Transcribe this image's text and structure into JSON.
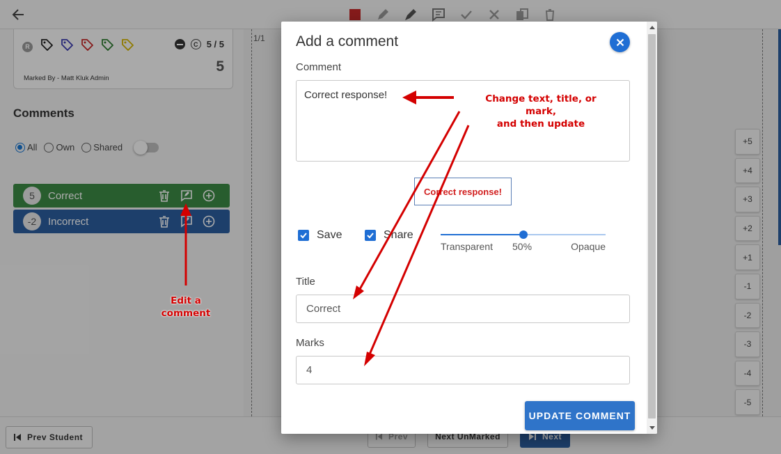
{
  "toolbar": {
    "icons": [
      "back-arrow-icon",
      "stop-icon",
      "pencil-icon",
      "marker-icon",
      "comment-icon",
      "check-icon",
      "cross-icon",
      "copy-icon",
      "trash-icon"
    ]
  },
  "mark_card": {
    "score_fraction": "5 / 5",
    "score_total": "5",
    "marked_by": "Marked By - Matt Kluk Admin",
    "tag_colors": [
      "#222222",
      "#3b3bb0",
      "#c62828",
      "#2e7d32",
      "#d4b400"
    ]
  },
  "comments_panel": {
    "heading": "Comments",
    "filters": [
      "All",
      "Own",
      "Shared"
    ],
    "selected_filter": "All",
    "items": [
      {
        "mark": "5",
        "title": "Correct",
        "color": "#3c8a45"
      },
      {
        "mark": "-2",
        "title": "Incorrect",
        "color": "#2c5e9e"
      }
    ]
  },
  "document": {
    "page_count": "1/1"
  },
  "quick_marks": [
    "+5",
    "+4",
    "+3",
    "+2",
    "+1",
    "-1",
    "-2",
    "-3",
    "-4",
    "-5"
  ],
  "bottom_bar": {
    "prev_student": "Prev Student",
    "prev": "Prev",
    "next_unmarked": "Next UnMarked",
    "next": "Next"
  },
  "modal": {
    "title": "Add a comment",
    "comment_label": "Comment",
    "comment_value": "Correct response!",
    "preview_text": "Correct response!",
    "save_label": "Save",
    "save_checked": true,
    "share_label": "Share",
    "share_checked": true,
    "opacity": {
      "left_label": "Transparent",
      "value_label": "50%",
      "right_label": "Opaque",
      "value": 0.5
    },
    "title_label": "Title",
    "title_value": "Correct",
    "marks_label": "Marks",
    "marks_value": "4",
    "update_button": "UPDATE COMMENT",
    "accent_color": "#1f6ed4"
  },
  "annotations": {
    "main_line1": "Change text, title, or mark,",
    "main_line2": "and then update",
    "edit": "Edit a comment",
    "color": "#d40000"
  }
}
